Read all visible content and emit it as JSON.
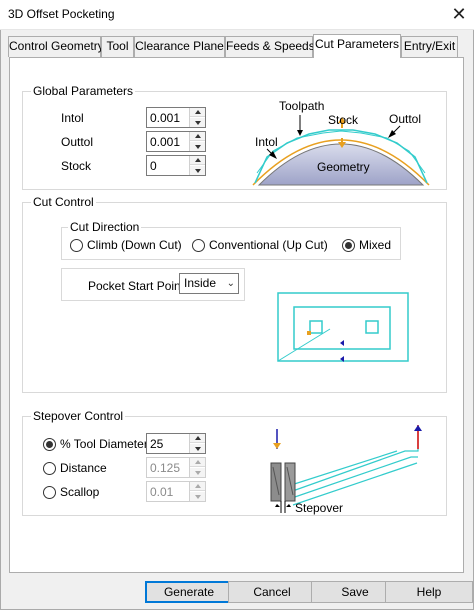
{
  "window": {
    "title": "3D Offset Pocketing",
    "close_symbol": "✕"
  },
  "tabs": [
    {
      "label": "Control Geometry",
      "active": false
    },
    {
      "label": "Tool",
      "active": false
    },
    {
      "label": "Clearance Plane",
      "active": false
    },
    {
      "label": "Feeds & Speeds",
      "active": false
    },
    {
      "label": "Cut Parameters",
      "active": true
    },
    {
      "label": "Entry/Exit",
      "active": false
    }
  ],
  "global_parameters": {
    "title": "Global Parameters",
    "intol": {
      "label": "Intol",
      "value": "0.001"
    },
    "outtol": {
      "label": "Outtol",
      "value": "0.001"
    },
    "stock": {
      "label": "Stock",
      "value": "0"
    },
    "diagram": {
      "toolpath": "Toolpath",
      "stock": "Stock",
      "outtol": "Outtol",
      "intol": "Intol",
      "geometry": "Geometry"
    }
  },
  "cut_control": {
    "title": "Cut Control",
    "cut_direction": {
      "title": "Cut Direction",
      "options": [
        {
          "label": "Climb (Down Cut)",
          "selected": false
        },
        {
          "label": "Conventional (Up Cut)",
          "selected": false
        },
        {
          "label": "Mixed",
          "selected": true
        }
      ]
    },
    "pocket_start_point": {
      "label": "Pocket Start Point",
      "value": "Inside"
    }
  },
  "stepover_control": {
    "title": "Stepover Control",
    "options": [
      {
        "label": "% Tool Diameter",
        "selected": true,
        "value": "25",
        "enabled": true
      },
      {
        "label": "Distance",
        "selected": false,
        "value": "0.125",
        "enabled": false
      },
      {
        "label": "Scallop",
        "selected": false,
        "value": "0.01",
        "enabled": false
      }
    ],
    "diagram": {
      "stepover": "Stepover"
    }
  },
  "buttons": {
    "generate": "Generate",
    "cancel": "Cancel",
    "save": "Save",
    "help": "Help"
  },
  "colors": {
    "accent": "#0078d7",
    "toolpath_cyan": "#33cccc",
    "stock_orange": "#e8a020",
    "arrow_blue": "#1a1aaa",
    "geometry_gray": "#b8bcd8"
  }
}
